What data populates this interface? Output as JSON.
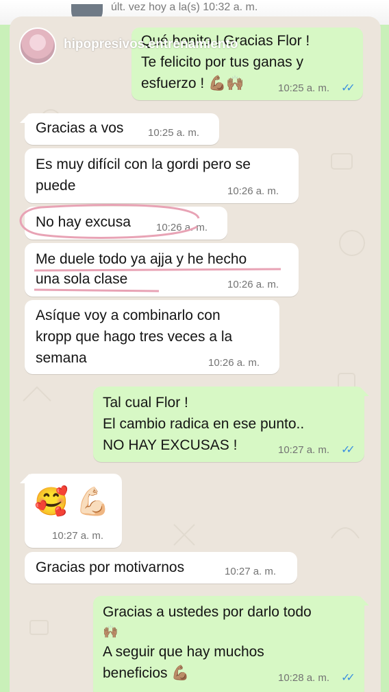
{
  "header": {
    "status": "últ. vez hoy a la(s) 10:32 a. m.",
    "profile_name": "hipopresivos.entrenamiento"
  },
  "colors": {
    "incoming": "#ffffff",
    "outgoing": "#d7f8c5",
    "read_ticks": "#3b8fe0",
    "highlight": "#e8a3b5",
    "background": "#c9f0b9"
  },
  "messages": [
    {
      "dir": "out",
      "lines": [
        "Qué bonito ! Gracias Flor !",
        "Te felicito por tus ganas y",
        "esfuerzo ! 💪🏽🙌🏽"
      ],
      "time": "10:25 a. m.",
      "read": true
    },
    {
      "dir": "in",
      "lines": [
        "Gracias a vos"
      ],
      "time": "10:25 a. m."
    },
    {
      "dir": "in",
      "lines": [
        "Es muy difícil con la gordi pero se",
        "puede"
      ],
      "time": "10:26 a. m."
    },
    {
      "dir": "in",
      "lines": [
        "No hay excusa"
      ],
      "time": "10:26 a. m."
    },
    {
      "dir": "in",
      "lines": [
        "Me duele todo ya ajja y he hecho",
        "una sola clase"
      ],
      "time": "10:26 a. m."
    },
    {
      "dir": "in",
      "lines": [
        "Asíque voy a combinarlo con",
        "kropp que hago tres veces a la",
        "semana"
      ],
      "time": "10:26 a. m."
    },
    {
      "dir": "out",
      "lines": [
        "Tal cual Flor !",
        "El cambio radica en ese punto..",
        "NO HAY EXCUSAS !"
      ],
      "time": "10:27 a. m.",
      "read": true
    },
    {
      "dir": "in",
      "lines": [
        "🥰 💪🏻"
      ],
      "time": "10:27 a. m."
    },
    {
      "dir": "in",
      "lines": [
        "Gracias por motivarnos"
      ],
      "time": "10:27 a. m."
    },
    {
      "dir": "out",
      "lines": [
        "Gracias a ustedes por darlo todo",
        "🙌🏽",
        "A seguir que hay muchos",
        "beneficios 💪🏽"
      ],
      "time": "10:28 a. m.",
      "read": true
    }
  ]
}
